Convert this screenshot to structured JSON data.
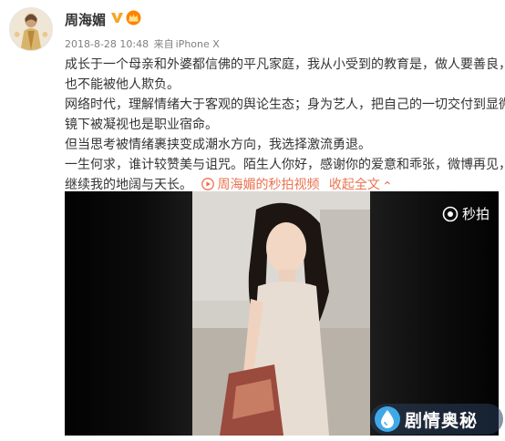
{
  "post": {
    "username": "周海媚",
    "timestamp": "2018-8-28 10:48",
    "source_prefix": "来自",
    "source_device": "iPhone X",
    "lines": [
      "成长于一个母亲和外婆都信佛的平凡家庭，我从小受到的教育是，做人要善良，",
      "也不能被他人欺负。",
      "网络时代，理解情绪大于客观的舆论生态；身为艺人，把自己的一切交付到显微",
      "镜下被凝视也是职业宿命。",
      "但当思考被情绪裹挟变成潮水方向，我选择激流勇退。",
      "一生何求，谁计较赞美与诅咒。陌生人你好，感谢你的爱意和乖张，微博再见，"
    ],
    "last_line": "继续我的地阔与天长。",
    "video_link_label": "周海媚的秒拍视频",
    "expand_label": "收起全文",
    "expand_arrow": "⌄"
  },
  "video": {
    "brand_label": "秒拍",
    "brand_icon": "miaopai-camera-icon"
  },
  "watermark": {
    "text": "剧情奥秘",
    "icon": "droplet-logo-icon"
  },
  "colors": {
    "link": "#eb7350",
    "verified": "#f5a623",
    "vip": "#ff8200"
  }
}
